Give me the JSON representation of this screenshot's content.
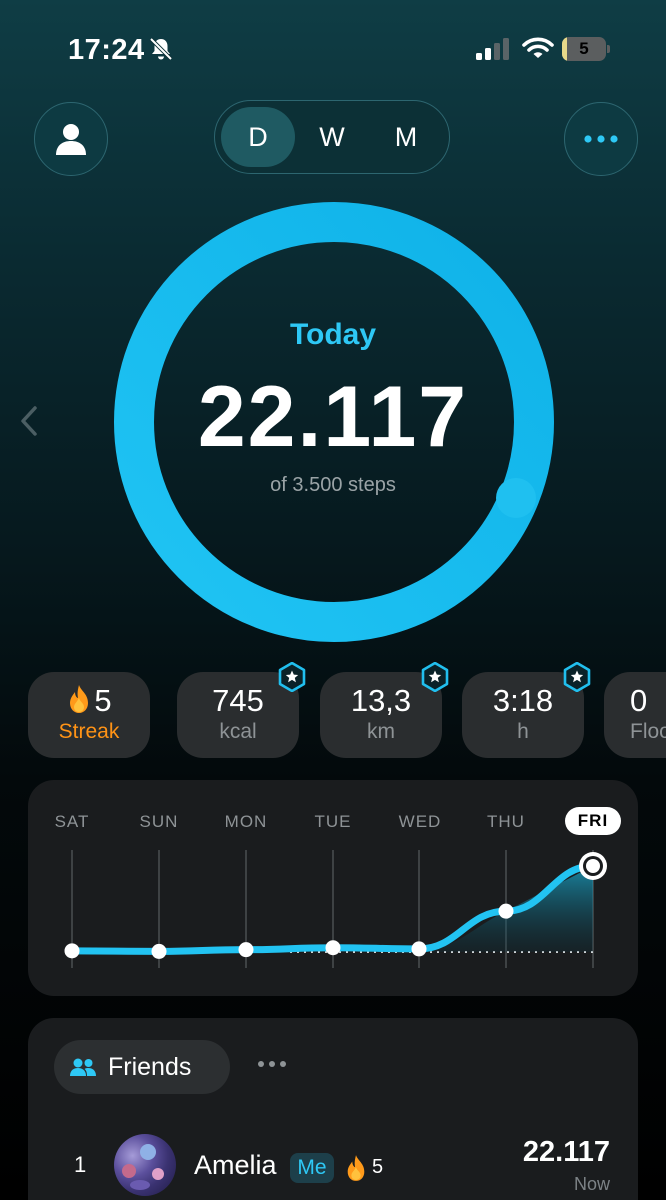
{
  "status_bar": {
    "time": "17:24",
    "battery_level": "5",
    "battery_fraction": 0.05
  },
  "header": {
    "periods": [
      {
        "label": "D",
        "active": true
      },
      {
        "label": "W",
        "active": false
      },
      {
        "label": "M",
        "active": false
      }
    ]
  },
  "summary": {
    "title": "Today",
    "steps": "22.117",
    "goal_text": "of 3.500 steps",
    "progress_fraction": 1.0
  },
  "stats": [
    {
      "value": "5",
      "unit": "Streak",
      "icon": "flame-icon",
      "badge": false
    },
    {
      "value": "745",
      "unit": "kcal",
      "badge": true
    },
    {
      "value": "13,3",
      "unit": "km",
      "badge": true
    },
    {
      "value": "3:18",
      "unit": "h",
      "badge": true
    },
    {
      "value": "0",
      "unit": "Floors",
      "badge": false
    }
  ],
  "week": {
    "days": [
      "SAT",
      "SUN",
      "MON",
      "TUE",
      "WED",
      "THU",
      "FRI"
    ],
    "current_day": "FRI"
  },
  "chart_data": {
    "type": "line",
    "categories": [
      "SAT",
      "SUN",
      "MON",
      "TUE",
      "WED",
      "THU",
      "FRI"
    ],
    "values": [
      300,
      150,
      600,
      1100,
      800,
      10500,
      22117
    ],
    "goal": 3500,
    "ylim": [
      0,
      22117
    ],
    "grid": true
  },
  "friends": {
    "tab_label": "Friends",
    "entries": [
      {
        "rank": "1",
        "name": "Amelia",
        "badge": "Me",
        "streak": "5",
        "steps": "22.117",
        "time": "Now"
      }
    ]
  },
  "colors": {
    "accent": "#2ec8f5",
    "streak": "#ff9316",
    "card": "#1a1c1e",
    "pill": "#2a2d2f"
  }
}
